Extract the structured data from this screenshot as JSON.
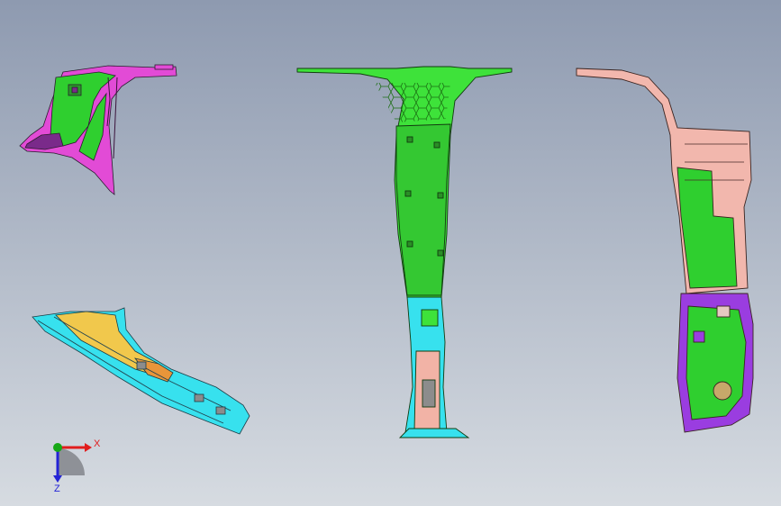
{
  "viewport": {
    "background_top": "#8e9ab0",
    "background_bottom": "#d6dbe1"
  },
  "parts": [
    {
      "name": "upper-left-trim-part",
      "colors": [
        "#e24bd6",
        "#2fcf2f",
        "#7a2a8a"
      ]
    },
    {
      "name": "lower-left-pillar-trim-part",
      "colors": [
        "#37e1ee",
        "#f1c84c",
        "#e8953a"
      ]
    },
    {
      "name": "center-b-pillar-trim-part",
      "colors": [
        "#3ee23a",
        "#37e1ee",
        "#f2b3a6"
      ]
    },
    {
      "name": "right-pillar-trim-part",
      "colors": [
        "#f2b7ad",
        "#2fcf2f",
        "#9a3de0"
      ]
    }
  ],
  "triad": {
    "x_label": "X",
    "z_label": "Z",
    "x_color": "#e11d1d",
    "y_color": "#16a816",
    "z_color": "#2323d6"
  }
}
